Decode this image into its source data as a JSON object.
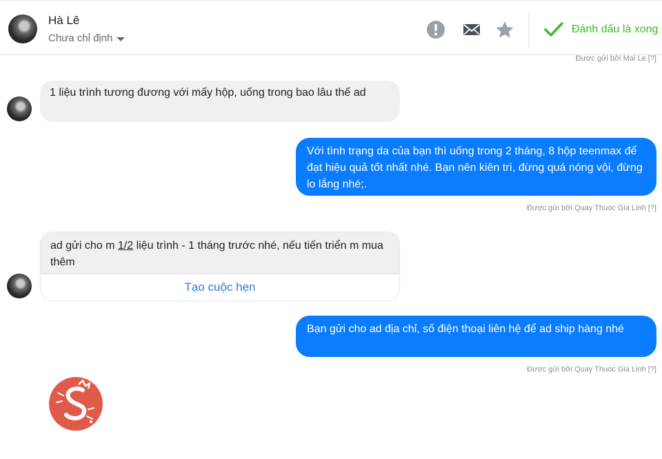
{
  "header": {
    "contact_name": "Hà Lê",
    "assignee": "Chưa chỉ định",
    "actions": {
      "spam_icon": "exclamation-icon",
      "unread_icon": "envelope-icon",
      "star_icon": "star-icon",
      "done_label": "Đánh dấu là xong"
    }
  },
  "conversation": {
    "top_sent_by": "Được gửi bởi Mai Le [?]",
    "messages": [
      {
        "from": "customer",
        "text": "1 liệu trình tương đương với mấy hộp, uống trong bao lâu thế ad"
      },
      {
        "from": "page",
        "text": "Với tình trạng da của bạn thì uống trong 2 tháng, 8 hộp teenmax để đạt hiệu quả tốt nhất nhé. Bạn nên kiên trì, đừng quá nóng vội, đừng lo lắng nhé;.",
        "sent_by": "Được gửi bởi Quay Thuoc Gia Linh [?]"
      },
      {
        "from": "customer",
        "text_before": "ad gửi cho m ",
        "text_underlined": "1/2",
        "text_after": " liệu trình - 1 tháng trước nhé, nếu tiến triển m mua thêm",
        "action_label": "Tạo cuộc hẹn"
      },
      {
        "from": "page",
        "text": "Bạn gửi cho ad địa chỉ, số điện thoại liên hệ để ad ship hàng nhé",
        "sent_by": "Được gửi bởi Quay Thuoc Gia Linh [?]"
      }
    ]
  },
  "colors": {
    "outgoing_bubble": "#0a7cff",
    "incoming_bubble": "#f0f0f0",
    "done_green": "#42b72a",
    "link_blue": "#3578e5",
    "logo_red": "#e05a4a"
  }
}
